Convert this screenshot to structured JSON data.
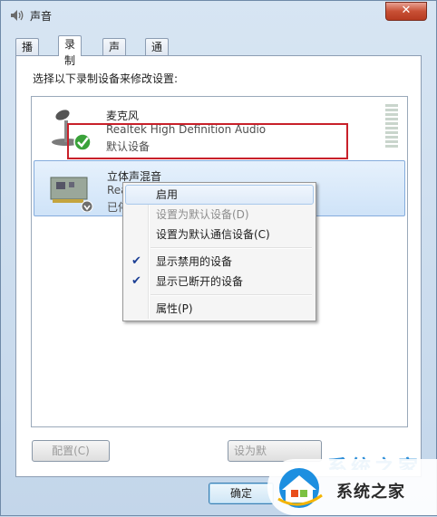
{
  "window": {
    "title": "声音",
    "close_label": "✕"
  },
  "tabs": [
    {
      "label": "播放"
    },
    {
      "label": "录制"
    },
    {
      "label": "声音"
    },
    {
      "label": "通信"
    }
  ],
  "panel": {
    "instruction": "选择以下录制设备来修改设置:"
  },
  "devices": [
    {
      "name": "麦克风",
      "driver": "Realtek High Definition Audio",
      "status": "默认设备"
    },
    {
      "name": "立体声混音",
      "driver": "Realtek",
      "status": "已停用"
    }
  ],
  "context_menu": {
    "items": [
      {
        "label": "启用"
      },
      {
        "label": "设置为默认设备(D)"
      },
      {
        "label": "设置为默认通信设备(C)"
      },
      {
        "label": "显示禁用的设备"
      },
      {
        "label": "显示已断开的设备"
      },
      {
        "label": "属性(P)"
      }
    ]
  },
  "buttons": {
    "configure": "配置(C)",
    "set_default": "设为默",
    "ok": "确定"
  },
  "watermark": {
    "text": "系统之家",
    "partial": "系统之家"
  },
  "colors": {
    "highlight": "#c8202a",
    "selected_bg": "#cfe3f8"
  }
}
